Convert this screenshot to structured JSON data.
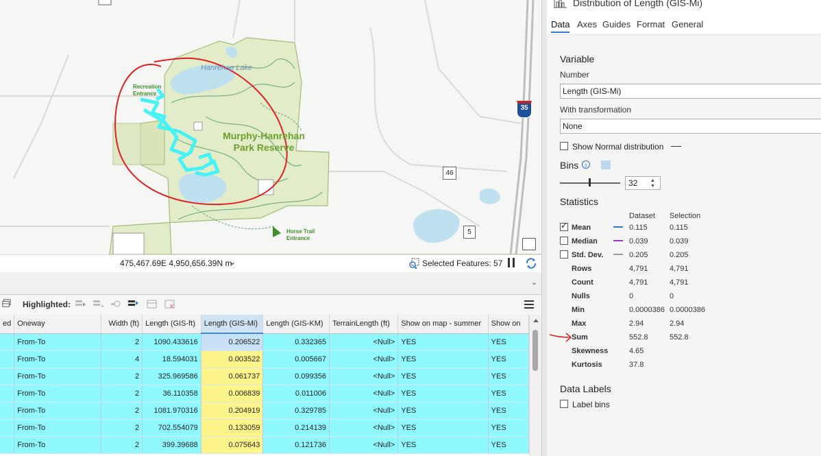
{
  "map": {
    "labels": {
      "lake": "Hanrehan Lake",
      "recreation": "Recreation Entrance",
      "park": "Murphy-Hanrehan Park Reserve",
      "horse": "Horse Trail Entrance",
      "interstate": "35",
      "route46": "46",
      "route5": "5"
    },
    "colors": {
      "park": "#e3ecc9",
      "park_border": "#9fbc78",
      "water": "#bfe0ee",
      "trail": "#5fa47a",
      "highlight": "#47f2f5",
      "annotation": "#e02020"
    }
  },
  "status": {
    "coordinates": "475,467.69E 4,950,656.39N m",
    "selected_features": "Selected Features: 57"
  },
  "table_toolbar": {
    "highlighted_label": "Highlighted:"
  },
  "table": {
    "columns": [
      "ed",
      "Oneway",
      "Width (ft)",
      "Length (GIS-ft)",
      "Length (GIS-Mi)",
      "Length (GIS-KM)",
      "TerrainLength (ft)",
      "Show on map - summer",
      "Show on"
    ],
    "rows": [
      [
        "",
        "From-To",
        "2",
        "1090.433616",
        "0.206522",
        "0.332365",
        "<Null>",
        "YES",
        "YES"
      ],
      [
        "",
        "From-To",
        "4",
        "18.594031",
        "0.003522",
        "0.005667",
        "<Null>",
        "YES",
        "YES"
      ],
      [
        "",
        "From-To",
        "2",
        "325.969586",
        "0.061737",
        "0.099356",
        "<Null>",
        "YES",
        "YES"
      ],
      [
        "",
        "From-To",
        "2",
        "36.110358",
        "0.006839",
        "0.011006",
        "<Null>",
        "YES",
        "YES"
      ],
      [
        "",
        "From-To",
        "2",
        "1081.970316",
        "0.204919",
        "0.329785",
        "<Null>",
        "YES",
        "YES"
      ],
      [
        "",
        "From-To",
        "2",
        "702.554079",
        "0.133059",
        "0.214139",
        "<Null>",
        "YES",
        "YES"
      ],
      [
        "",
        "From-To",
        "2",
        "399.39688",
        "0.075643",
        "0.121736",
        "<Null>",
        "YES",
        "YES"
      ]
    ]
  },
  "panel": {
    "title": "Distribution of Length (GIS-Mi)",
    "tabs": [
      "Data",
      "Axes",
      "Guides",
      "Format",
      "General"
    ],
    "variable": {
      "section": "Variable",
      "number_label": "Number",
      "number_value": "Length (GIS-Mi)",
      "transform_label": "With transformation",
      "transform_value": "None",
      "normal_label": "Show Normal distribution"
    },
    "bins": {
      "label": "Bins",
      "value": "32"
    },
    "statistics": {
      "section": "Statistics",
      "col_dataset": "Dataset",
      "col_selection": "Selection",
      "rows": [
        {
          "name": "Mean",
          "dataset": "0.115",
          "selection": "0.115",
          "checked": true,
          "line": "#2f6fd6"
        },
        {
          "name": "Median",
          "dataset": "0.039",
          "selection": "0.039",
          "checked": false,
          "line": "#9a2fc8"
        },
        {
          "name": "Std. Dev.",
          "dataset": "0.205",
          "selection": "0.205",
          "checked": false,
          "line": "#9a9a9a"
        },
        {
          "name": "Rows",
          "dataset": "4,791",
          "selection": "4,791"
        },
        {
          "name": "Count",
          "dataset": "4,791",
          "selection": "4,791"
        },
        {
          "name": "Nulls",
          "dataset": "0",
          "selection": "0"
        },
        {
          "name": "Min",
          "dataset": "0.0000386",
          "selection": "0.0000386"
        },
        {
          "name": "Max",
          "dataset": "2.94",
          "selection": "2.94"
        },
        {
          "name": "Sum",
          "dataset": "552.8",
          "selection": "552.8"
        },
        {
          "name": "Skewness",
          "dataset": "4.65",
          "selection": ""
        },
        {
          "name": "Kurtosis",
          "dataset": "37.8",
          "selection": ""
        }
      ]
    },
    "data_labels": {
      "section": "Data Labels",
      "label_bins": "Label bins"
    }
  }
}
